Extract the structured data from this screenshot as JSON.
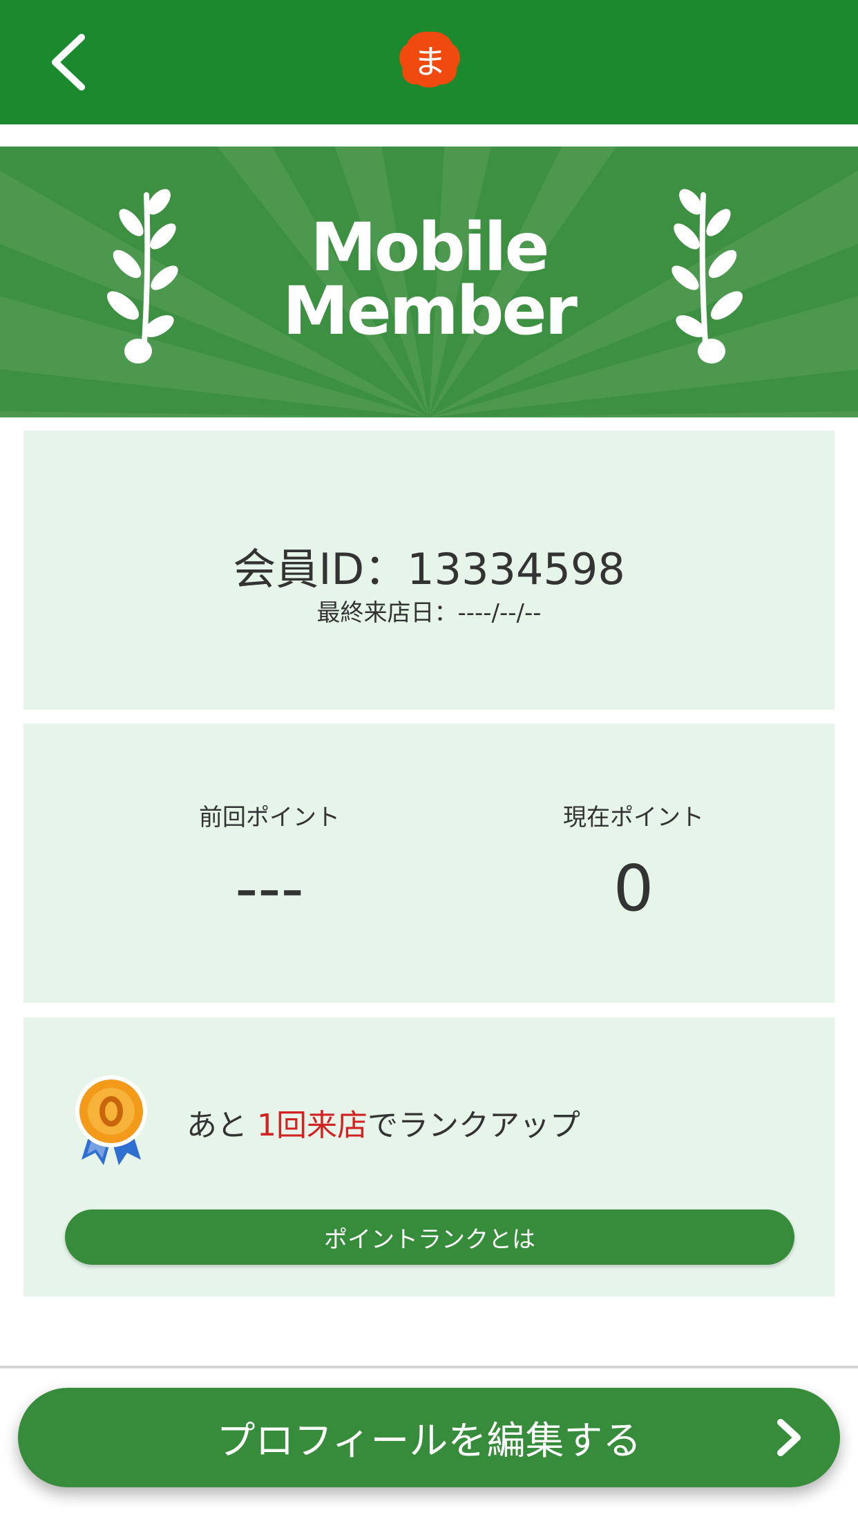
{
  "header": {
    "back_icon": "chevron-left-icon",
    "logo_text": "ま",
    "logo_color": "#f04a0f",
    "background": "#1b8a2e"
  },
  "banner": {
    "title_line1": "Mobile",
    "title_line2": "Member",
    "laurel_icon": "laurel-branch-icon"
  },
  "member": {
    "id_text": "会員ID：13334598",
    "last_visit_text": "最終来店日：----/--/--"
  },
  "points": {
    "previous_label": "前回ポイント",
    "previous_value": "---",
    "current_label": "現在ポイント",
    "current_value": "0"
  },
  "rank": {
    "medal_icon": "medal-icon",
    "text_prefix": "あと ",
    "text_highlight": "1回来店",
    "text_suffix": "でランクアップ",
    "highlight_color": "#d32222",
    "button_label": "ポイントランクとは"
  },
  "footer": {
    "edit_profile_label": "プロフィールを編集する",
    "chevron_icon": "chevron-right-icon"
  },
  "colors": {
    "card_background": "#e6f4ea",
    "button_green": "#378c3b"
  }
}
